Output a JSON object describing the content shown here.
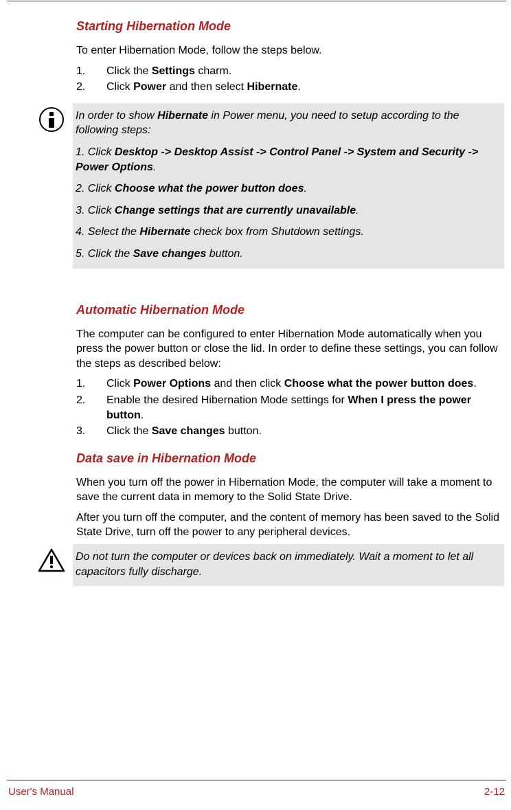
{
  "section1": {
    "heading": "Starting Hibernation Mode",
    "intro": "To enter Hibernation Mode, follow the steps below.",
    "steps": [
      {
        "num": "1.",
        "pre": "Click the ",
        "bold": "Settings",
        "post": " charm."
      },
      {
        "num": "2.",
        "pre": "Click ",
        "bold1": "Power",
        "mid": " and then select ",
        "bold2": "Hibernate",
        "post": "."
      }
    ]
  },
  "note1": {
    "p1_pre": "In order to show ",
    "p1_bold": "Hibernate",
    "p1_post": " in Power menu, you need to setup according to the following steps:",
    "p2_pre": "1. Click ",
    "p2_bold": "Desktop -> Desktop Assist -> Control Panel -> System and Security -> Power Options",
    "p2_post": ".",
    "p3_pre": "2. Click ",
    "p3_bold": "Choose what the power button does",
    "p3_post": ".",
    "p4_pre": "3. Click ",
    "p4_bold": "Change settings that are currently unavailable",
    "p4_post": ".",
    "p5_pre": "4. Select the ",
    "p5_bold": "Hibernate",
    "p5_post": " check box from Shutdown settings.",
    "p6_pre": "5. Click the ",
    "p6_bold": "Save changes",
    "p6_post": " button."
  },
  "section2": {
    "heading": "Automatic Hibernation Mode",
    "intro": "The computer can be configured to enter Hibernation Mode automatically when you press the power button or close the lid. In order to define these settings, you can follow the steps as described below:",
    "steps": [
      {
        "num": "1.",
        "pre": "Click ",
        "bold1": "Power Options",
        "mid": " and then click ",
        "bold2": "Choose what the power button does",
        "post": "."
      },
      {
        "num": "2.",
        "pre": "Enable the desired Hibernation Mode settings for ",
        "bold1": "When I press the power button",
        "post": "."
      },
      {
        "num": "3.",
        "pre": "Click the ",
        "bold1": "Save changes",
        "post": " button."
      }
    ]
  },
  "section3": {
    "heading": "Data save in Hibernation Mode",
    "p1": "When you turn off the power in Hibernation Mode, the computer will take a moment to save the current data in memory to the Solid State Drive.",
    "p2": "After you turn off the computer, and the content of memory has been saved to the Solid State Drive, turn off the power to any peripheral devices."
  },
  "note2": {
    "text": "Do not turn the computer or devices back on immediately. Wait a moment to let all capacitors fully discharge."
  },
  "footer": {
    "left": "User's Manual",
    "right": "2-12"
  }
}
